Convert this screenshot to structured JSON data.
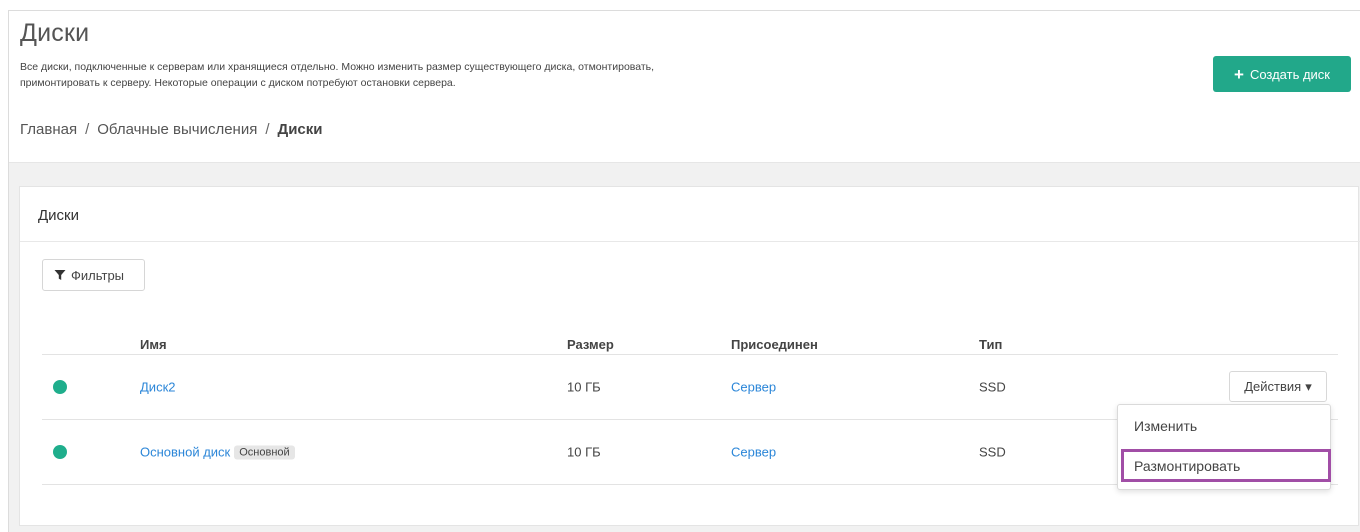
{
  "header": {
    "title": "Диски",
    "description_line1": "Все диски, подключенные к серверам или хранящиеся отдельно. Можно изменить размер существующего диска, отмонтировать,",
    "description_line2": "примонтировать к серверу. Некоторые операции с диском потребуют остановки сервера.",
    "create_button": "Создать диск",
    "create_icon": "plus-icon"
  },
  "breadcrumb": {
    "items": [
      "Главная",
      "Облачные вычисления",
      "Диски"
    ],
    "separator": "/"
  },
  "card": {
    "title": "Диски",
    "filter_button": "Фильтры",
    "filter_icon": "filter-icon"
  },
  "table": {
    "columns": [
      "Имя",
      "Размер",
      "Присоединен",
      "Тип"
    ],
    "rows": [
      {
        "name": "Диск2",
        "badge": "",
        "size": "10 ГБ",
        "attached": "Сервер",
        "type": "SSD",
        "status_color": "#1fae8c"
      },
      {
        "name": "Основной диск",
        "badge": "Основной",
        "size": "10 ГБ",
        "attached": "Сервер",
        "type": "SSD",
        "status_color": "#1fae8c"
      }
    ],
    "actions_button": "Действия"
  },
  "dropdown": {
    "items": [
      "Изменить",
      "Размонтировать"
    ],
    "highlighted_item": "Размонтировать"
  },
  "colors": {
    "accent": "#22a88a",
    "link": "#2b86d8",
    "highlight_border": "#a14ea6"
  }
}
